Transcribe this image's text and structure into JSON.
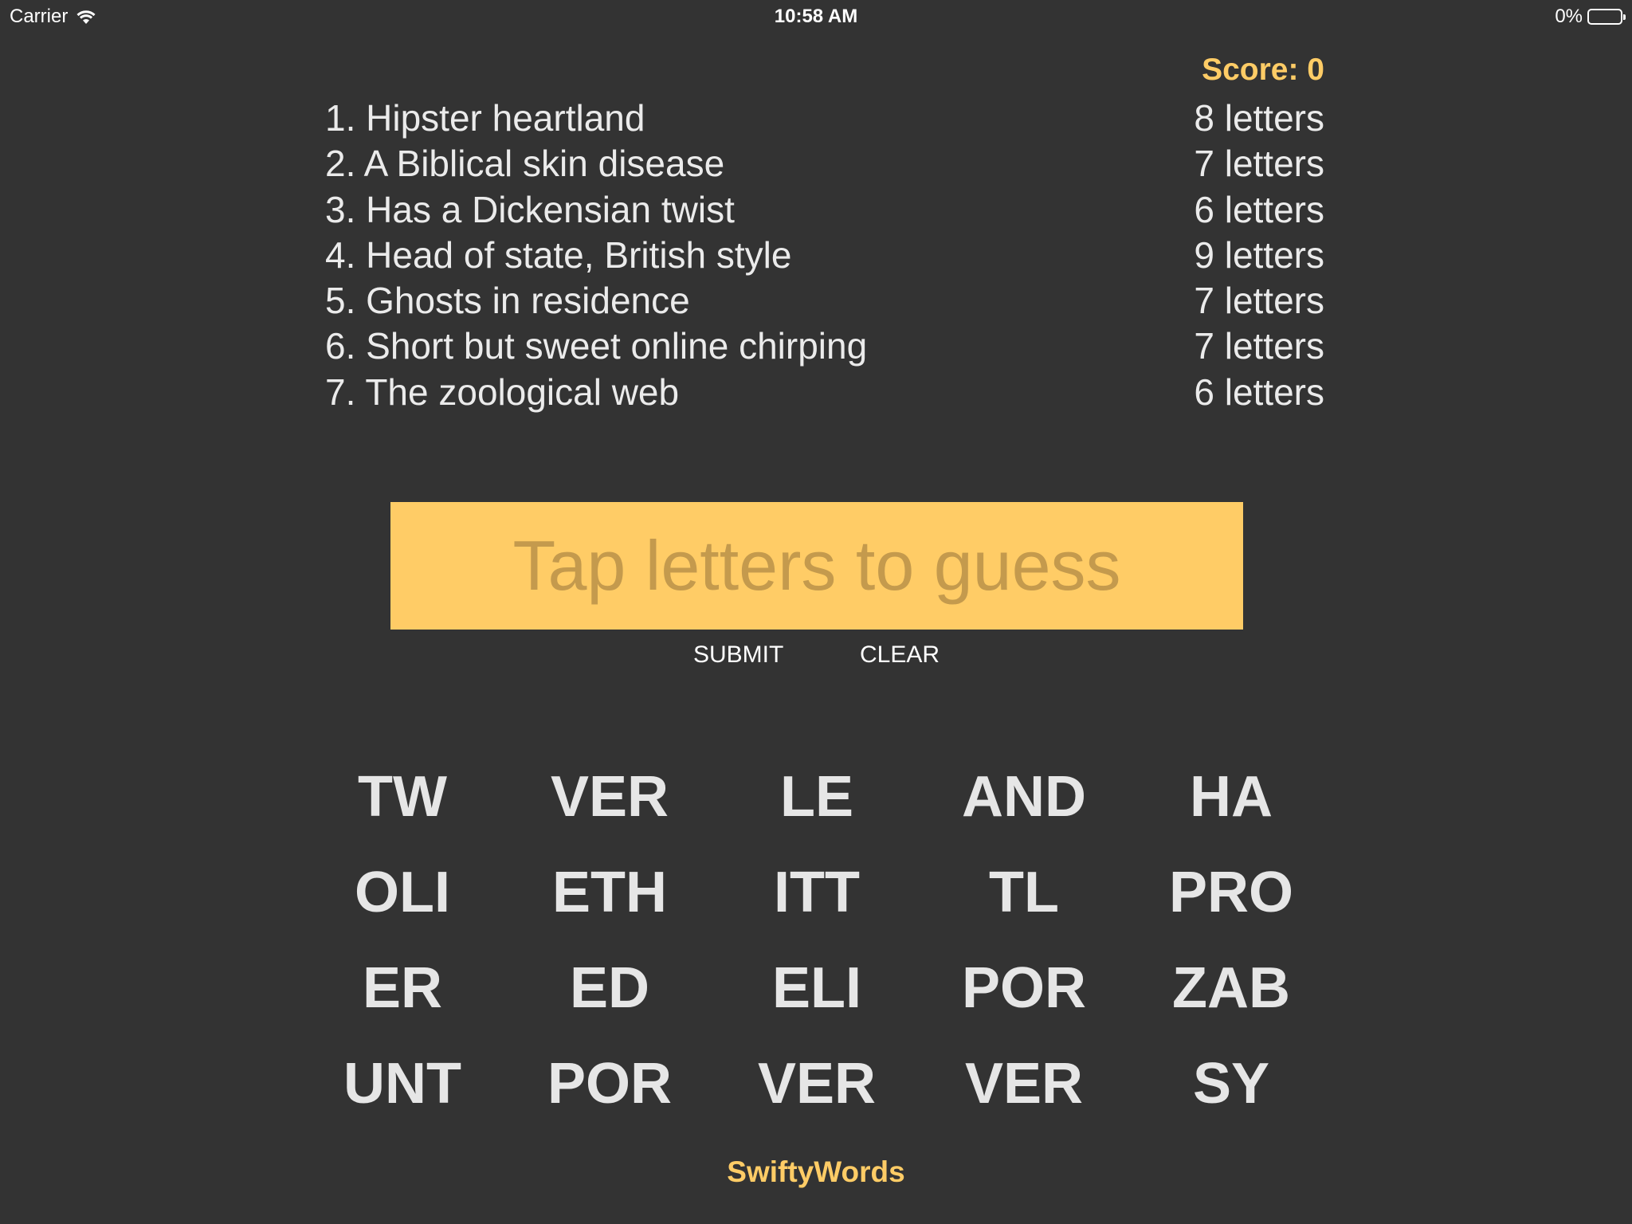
{
  "status_bar": {
    "carrier": "Carrier",
    "time": "10:58 AM",
    "battery_percent": "0%"
  },
  "score": {
    "text": "Score: 0"
  },
  "clues": [
    {
      "text": "1. Hipster heartland",
      "count": "8 letters"
    },
    {
      "text": "2. A Biblical skin disease",
      "count": "7 letters"
    },
    {
      "text": "3. Has a Dickensian twist",
      "count": "6 letters"
    },
    {
      "text": "4. Head of state, British style",
      "count": "9 letters"
    },
    {
      "text": "5. Ghosts in residence",
      "count": "7 letters"
    },
    {
      "text": "6. Short but sweet online chirping",
      "count": "7 letters"
    },
    {
      "text": "7. The zoological web",
      "count": "6 letters"
    }
  ],
  "answer": {
    "placeholder": "Tap letters to guess",
    "value": ""
  },
  "buttons": {
    "submit": "SUBMIT",
    "clear": "CLEAR"
  },
  "letter_groups": [
    "TW",
    "VER",
    "LE",
    "AND",
    "HA",
    "OLI",
    "ETH",
    "ITT",
    "TL",
    "PRO",
    "ER",
    "ED",
    "ELI",
    "POR",
    "ZAB",
    "UNT",
    "POR",
    "VER",
    "VER",
    "SY"
  ],
  "footer": {
    "title": "SwiftyWords"
  },
  "colors": {
    "background": "#333333",
    "accent": "#ffcc66",
    "placeholder_text": "#c49a4d",
    "text": "#ebebeb"
  },
  "icons": {
    "wifi": "wifi-icon",
    "battery": "battery-icon"
  }
}
